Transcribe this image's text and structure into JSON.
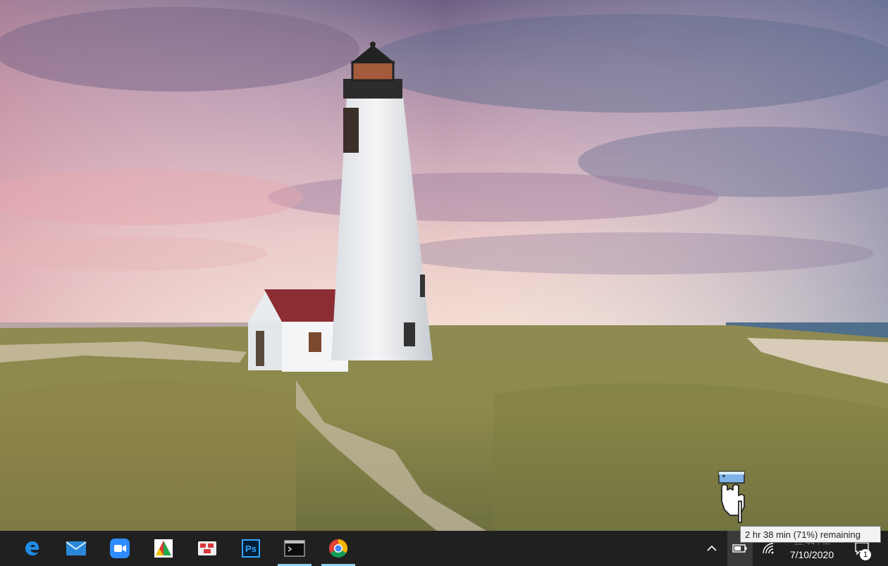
{
  "taskbar": {
    "apps": [
      {
        "name": "Microsoft Edge",
        "icon": "edge-icon",
        "running": false
      },
      {
        "name": "Mail",
        "icon": "mail-icon",
        "running": false
      },
      {
        "name": "Zoom",
        "icon": "zoom-icon",
        "running": false
      },
      {
        "name": "Paint 3D",
        "icon": "paint-3d-icon",
        "running": false
      },
      {
        "name": "Remote Desktop",
        "icon": "remote-desktop-icon",
        "running": false
      },
      {
        "name": "Adobe Photoshop",
        "icon": "photoshop-icon",
        "running": false
      },
      {
        "name": "Command Prompt",
        "icon": "terminal-icon",
        "running": true
      },
      {
        "name": "Google Chrome",
        "icon": "chrome-icon",
        "running": true
      }
    ],
    "photoshop_label": "Ps",
    "tray": {
      "show_hidden_icon": "chevron-up-icon",
      "battery_icon": "battery-icon",
      "network_icon": "wifi-icon",
      "notification_icon": "notification-icon",
      "notification_count": "1"
    },
    "clock": {
      "time": "12:44 PM",
      "date": "7/10/2020"
    }
  },
  "battery_tooltip": "2 hr 38 min (71%) remaining",
  "colors": {
    "taskbar_bg": "#202020",
    "running_indicator": "#8ad0ee",
    "tooltip_bg": "#f2f2f2"
  }
}
